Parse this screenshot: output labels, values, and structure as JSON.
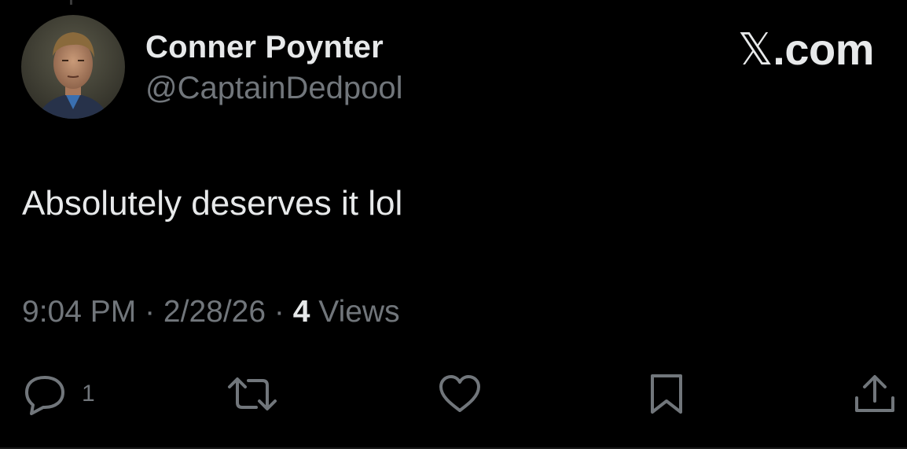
{
  "author": {
    "display_name": "Conner Poynter",
    "handle": "@CaptainDedpool"
  },
  "brand": {
    "x_glyph": "𝕏",
    "suffix": ".com"
  },
  "tweet": {
    "text": "Absolutely deserves it lol"
  },
  "meta": {
    "time": "9:04 PM",
    "separator": " · ",
    "date": "2/28/26",
    "views_count": "4",
    "views_label": " Views"
  },
  "actions": {
    "reply_count": "1",
    "icons": [
      "reply-icon",
      "repost-icon",
      "like-icon",
      "bookmark-icon",
      "share-icon"
    ]
  },
  "colors": {
    "background": "#000000",
    "primary_text": "#e7e9ea",
    "secondary_text": "#71767b"
  }
}
